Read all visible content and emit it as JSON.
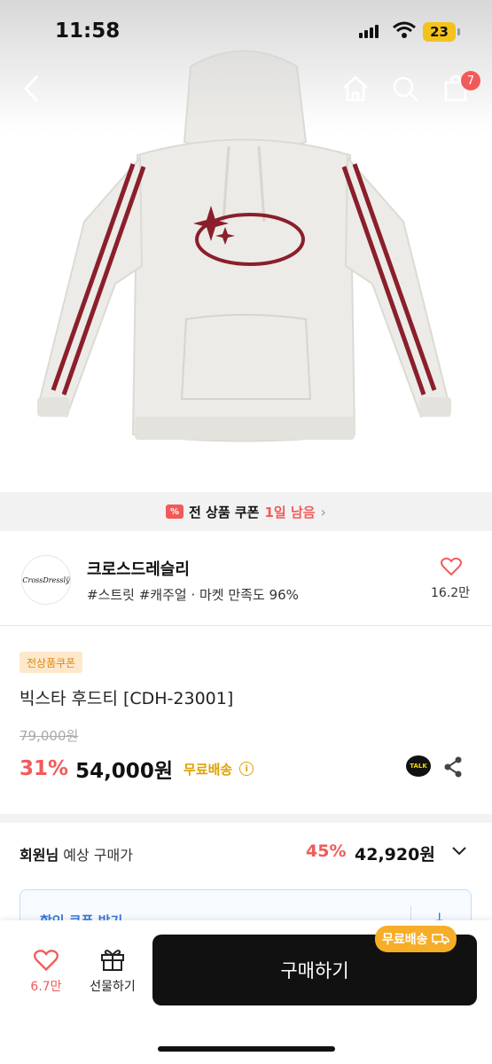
{
  "status_bar": {
    "time": "11:58",
    "battery": "23"
  },
  "nav": {
    "cart_count": "7"
  },
  "coupon_bar": {
    "label": "전 상품 쿠폰",
    "remaining": "1일 남음"
  },
  "seller": {
    "logo_text": "CrossDresslÿ",
    "name": "크로스드레슬리",
    "tags": "#스트릿 #캐주얼 · 마켓 만족도 96%",
    "likes": "16.2만"
  },
  "product": {
    "coupon_chip": "전상품쿠폰",
    "title": "빅스타 후드티 [CDH-23001]",
    "original_price": "79,000원",
    "discount": "31%",
    "price": "54,000원",
    "free_shipping": "무료배송"
  },
  "member_price": {
    "label_bold": "회원님",
    "label_rest": " 예상 구매가",
    "discount": "45%",
    "price": "42,920원"
  },
  "coupon_box": {
    "text": "할인 쿠폰 받기"
  },
  "bottom_bar": {
    "likes": "6.7만",
    "gift_label": "선물하기",
    "buy_label": "구매하기",
    "shipping_badge": "무료배송"
  },
  "colors": {
    "accent_red": "#f25a5a",
    "accent_orange": "#f6ad28",
    "hoodie_stripe": "#8a1f2b"
  }
}
